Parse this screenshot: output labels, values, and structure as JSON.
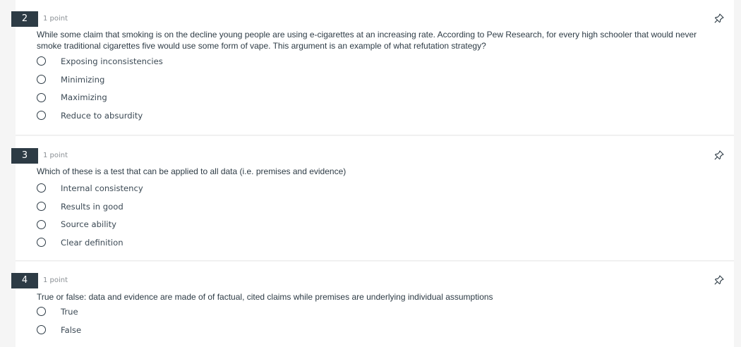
{
  "questions": [
    {
      "number": "2",
      "points": "1 point",
      "pin_icon": "pin-icon",
      "prompt": "While some claim that smoking is on the decline young people are using e-cigarettes at an increasing rate. According to Pew Research, for every high schooler that would never smoke traditional cigarettes five would use some form of vape. This argument is an example of what refutation strategy?",
      "answers": [
        "Exposing inconsistencies",
        "Minimizing",
        "Maximizing",
        "Reduce to absurdity"
      ]
    },
    {
      "number": "3",
      "points": "1 point",
      "pin_icon": "pin-icon",
      "prompt": "Which of these is a test that can be applied to all data (i.e. premises and evidence)",
      "answers": [
        "Internal consistency",
        "Results in good",
        "Source ability",
        "Clear definition"
      ]
    },
    {
      "number": "4",
      "points": "1 point",
      "pin_icon": "pin-icon",
      "prompt": "True or false: data and evidence are made of of factual, cited claims while premises are underlying individual assumptions",
      "answers": [
        "True",
        "False"
      ]
    }
  ]
}
